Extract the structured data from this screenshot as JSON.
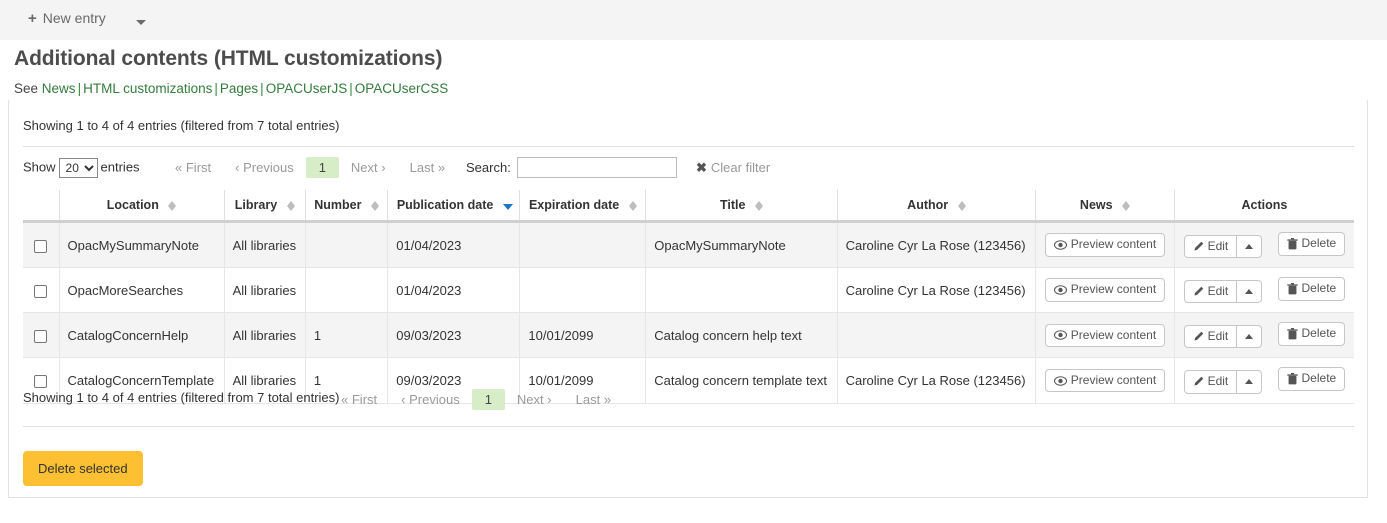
{
  "toolbar": {
    "new_entry_label": "New entry",
    "plus_glyph": "+",
    "dropdown_icon": "caret-down-icon"
  },
  "header": {
    "title": "Additional contents (HTML customizations)",
    "see_prefix": "See",
    "links": [
      "News",
      "HTML customizations",
      "Pages",
      "OPACUserJS",
      "OPACUserCSS"
    ],
    "separator": "|"
  },
  "table_info": {
    "top": "Showing 1 to 4 of 4 entries (filtered from 7 total entries)",
    "bottom": "Showing 1 to 4 of 4 entries (filtered from 7 total entries)"
  },
  "controls": {
    "show_label": "Show",
    "entries_label": "entries",
    "length_value": "20",
    "length_options": [
      "20"
    ],
    "search_label": "Search:",
    "search_value": "",
    "search_placeholder": "",
    "clear_filter_label": "Clear filter",
    "clear_filter_icon": "x-close-icon"
  },
  "pagination": {
    "first": "First",
    "previous": "Previous",
    "current_page": "1",
    "next": "Next",
    "last": "Last",
    "first_glyph": "«",
    "previous_glyph": "‹",
    "next_glyph": "›",
    "last_glyph": "»",
    "active_color": "#d6edc7"
  },
  "table": {
    "columns": [
      {
        "label": "",
        "sortable": false,
        "sort": "none"
      },
      {
        "label": "Location",
        "sortable": true,
        "sort": "none"
      },
      {
        "label": "Library",
        "sortable": true,
        "sort": "none"
      },
      {
        "label": "Number",
        "sortable": true,
        "sort": "none"
      },
      {
        "label": "Publication date",
        "sortable": true,
        "sort": "desc"
      },
      {
        "label": "Expiration date",
        "sortable": true,
        "sort": "none"
      },
      {
        "label": "Title",
        "sortable": true,
        "sort": "none"
      },
      {
        "label": "Author",
        "sortable": true,
        "sort": "none"
      },
      {
        "label": "News",
        "sortable": true,
        "sort": "none"
      },
      {
        "label": "Actions",
        "sortable": false,
        "sort": "none"
      }
    ],
    "rows": [
      {
        "selected": false,
        "location": "OpacMySummaryNote",
        "library": "All libraries",
        "number": "",
        "publication_date": "01/04/2023",
        "expiration_date": "",
        "title": "OpacMySummaryNote",
        "author": "Caroline Cyr La Rose (123456)",
        "preview_label": "Preview content",
        "edit_label": "Edit",
        "delete_label": "Delete"
      },
      {
        "selected": false,
        "location": "OpacMoreSearches",
        "library": "All libraries",
        "number": "",
        "publication_date": "01/04/2023",
        "expiration_date": "",
        "title": "",
        "author": "Caroline Cyr La Rose (123456)",
        "preview_label": "Preview content",
        "edit_label": "Edit",
        "delete_label": "Delete"
      },
      {
        "selected": false,
        "location": "CatalogConcernHelp",
        "library": "All libraries",
        "number": "1",
        "publication_date": "09/03/2023",
        "expiration_date": "10/01/2099",
        "title": "Catalog concern help text",
        "author": "",
        "preview_label": "Preview content",
        "edit_label": "Edit",
        "delete_label": "Delete"
      },
      {
        "selected": false,
        "location": "CatalogConcernTemplate",
        "library": "All libraries",
        "number": "1",
        "publication_date": "09/03/2023",
        "expiration_date": "10/01/2099",
        "title": "Catalog concern template text",
        "author": "Caroline Cyr La Rose (123456)",
        "preview_label": "Preview content",
        "edit_label": "Edit",
        "delete_label": "Delete"
      }
    ]
  },
  "footer": {
    "delete_selected_label": "Delete selected",
    "delete_selected_color": "#fcc032"
  },
  "icons": {
    "eye": "eye-icon",
    "pencil": "pencil-icon",
    "trash": "trash-icon",
    "caret_up": "caret-up-icon"
  }
}
